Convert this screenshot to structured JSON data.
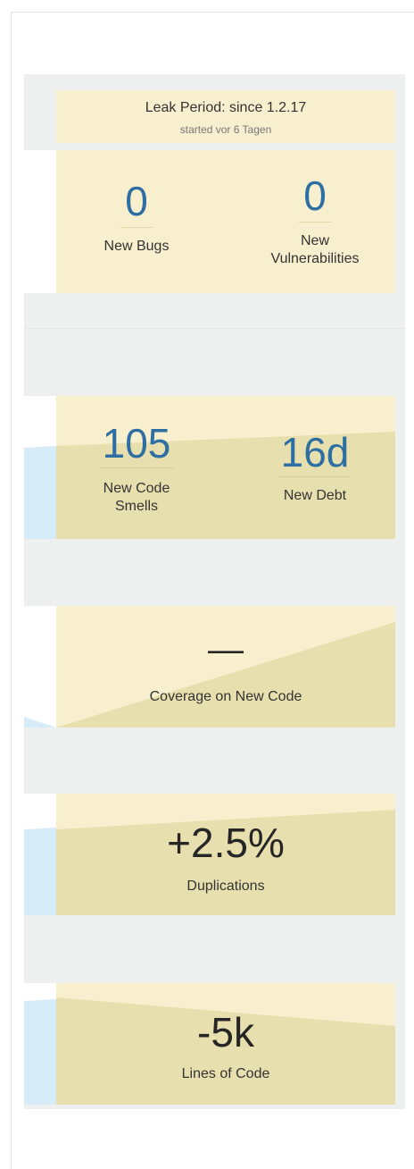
{
  "leak_period": {
    "title": "Leak Period: since 1.2.17",
    "subtitle": "started vor 6 Tagen"
  },
  "reliability_security": {
    "bugs": {
      "value": "0",
      "label": "New Bugs"
    },
    "vulnerabilities": {
      "value": "0",
      "label_line1": "New",
      "label_line2": "Vulnerabilities"
    }
  },
  "maintainability": {
    "code_smells": {
      "value": "105",
      "label_line1": "New Code",
      "label_line2": "Smells"
    },
    "debt": {
      "value": "16d",
      "label": "New Debt"
    }
  },
  "coverage": {
    "value": "—",
    "label": "Coverage on New Code"
  },
  "duplications": {
    "value": "+2.5%",
    "label": "Duplications"
  },
  "size": {
    "value": "-5k",
    "label": "Lines of Code"
  },
  "colors": {
    "card_bg": "#f8efcf",
    "card_shade": "#e8dfaf",
    "metric_blue": "#2d6fa3",
    "side_blue": "#d6ecf8",
    "page_gray": "#eeefef"
  }
}
